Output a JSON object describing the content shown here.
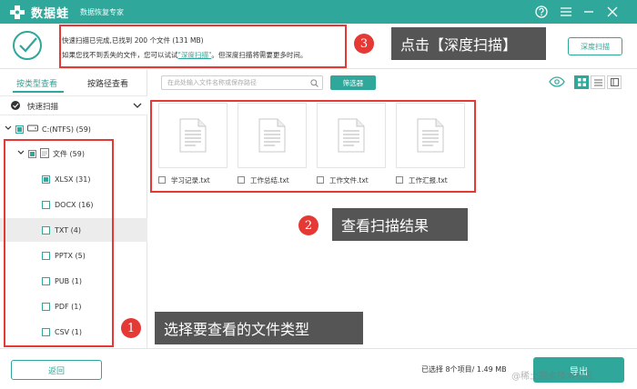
{
  "app": {
    "name": "数据蛙",
    "subtitle": "数据恢复专家"
  },
  "header": {
    "message_line1": "快速扫描已完成,已找到 200 个文件 (131 MB)",
    "message_line2_prefix": "如果您找不到丢失的文件，您可以试试",
    "message_line2_link": "\"深度扫描\"",
    "message_line2_suffix": "。但深度扫描将需要更多时间。",
    "deep_scan_button": "深度扫描"
  },
  "sidebar": {
    "tabs": [
      {
        "label": "按类型查看",
        "active": true
      },
      {
        "label": "按路径查看",
        "active": false
      }
    ],
    "scan_mode": "快速扫描",
    "tree": {
      "drive": "C:(NTFS) (59)",
      "folder": "文件 (59)",
      "types": [
        {
          "label": "XLSX (31)",
          "selected": false,
          "checked": "partial"
        },
        {
          "label": "DOCX (16)",
          "selected": false,
          "checked": "none"
        },
        {
          "label": "TXT (4)",
          "selected": true,
          "checked": "none"
        },
        {
          "label": "PPTX (5)",
          "selected": false,
          "checked": "none"
        },
        {
          "label": "PUB (1)",
          "selected": false,
          "checked": "none"
        },
        {
          "label": "PDF (1)",
          "selected": false,
          "checked": "none"
        },
        {
          "label": "CSV (1)",
          "selected": false,
          "checked": "none"
        }
      ]
    }
  },
  "toolbar": {
    "search_placeholder": "在此处输入文件名称或保存路径",
    "filter_button": "筛选器"
  },
  "files": [
    {
      "name": "学习记录.txt"
    },
    {
      "name": "工作总结.txt"
    },
    {
      "name": "工作文件.txt"
    },
    {
      "name": "工作汇报.txt"
    }
  ],
  "footer": {
    "back_button": "返回",
    "selection_info": "已选择 8个项目/ 1.49 MB",
    "export_button": "导出"
  },
  "annotations": [
    {
      "number": "1",
      "text": "选择要查看的文件类型"
    },
    {
      "number": "2",
      "text": "查看扫描结果"
    },
    {
      "number": "3",
      "text": "点击【深度扫描】"
    }
  ],
  "watermark": "@稀土掘金技术社区",
  "colors": {
    "brand": "#2fa79a",
    "annotation_red": "#e53935",
    "annotation_label_bg": "#555555"
  }
}
